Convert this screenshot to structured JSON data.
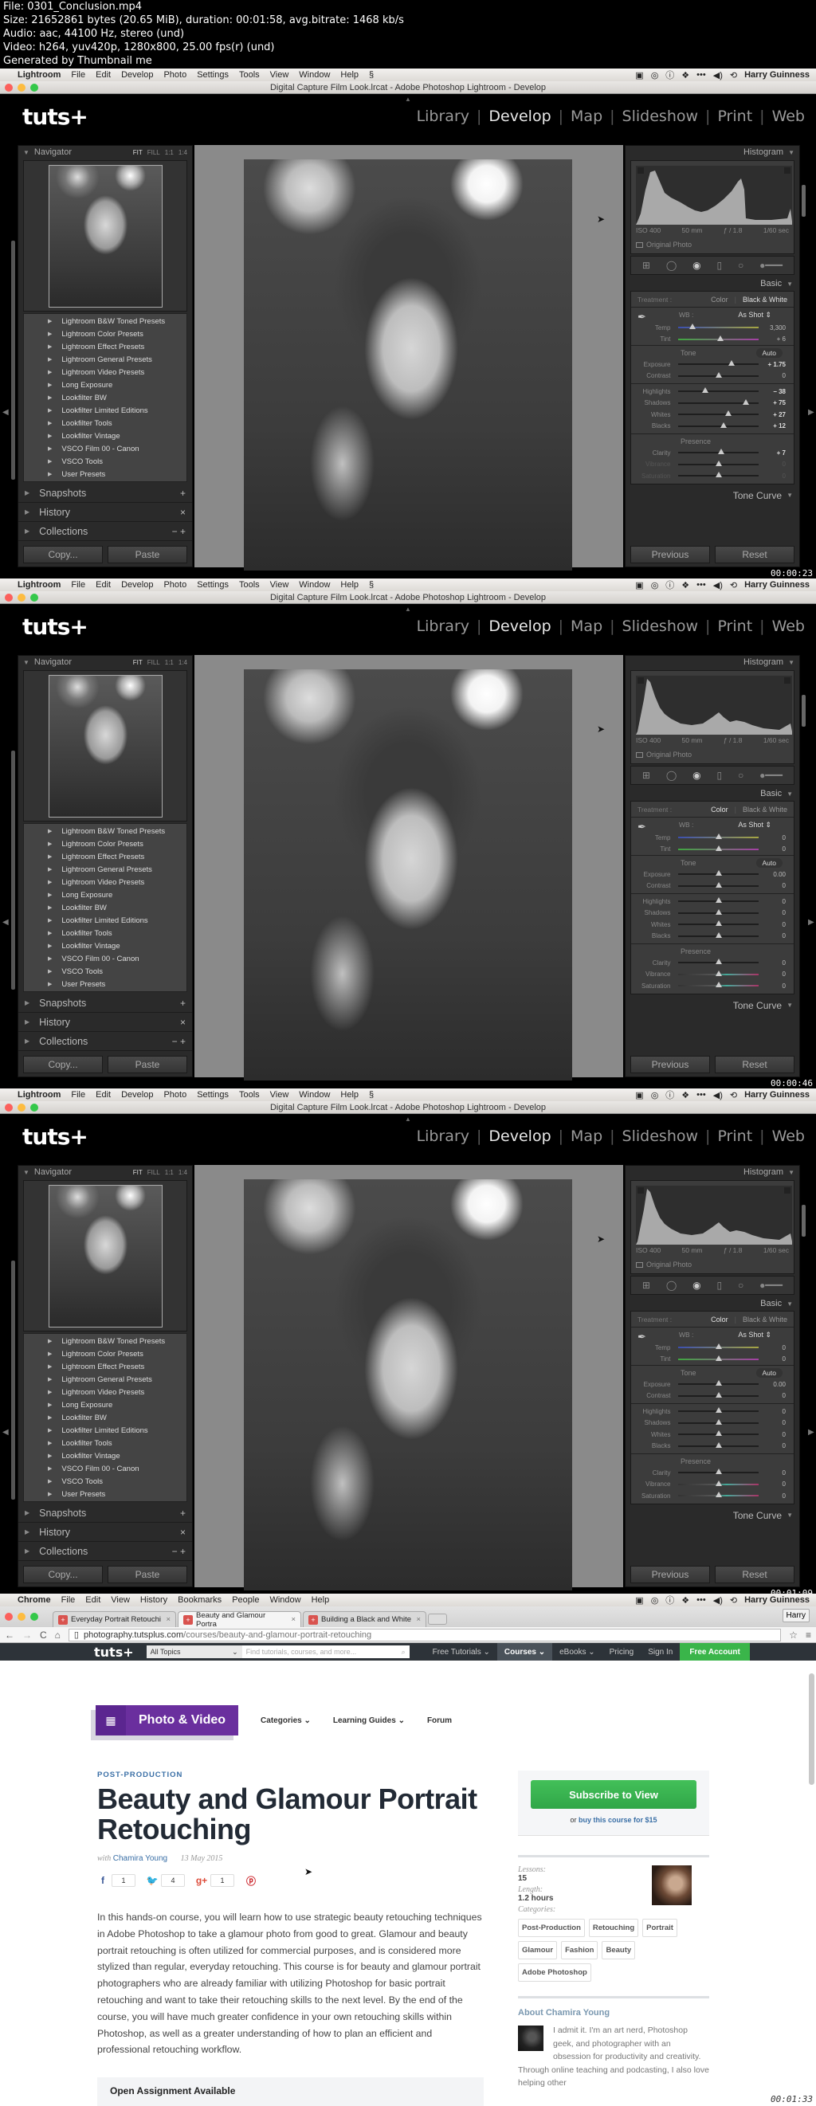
{
  "header": {
    "lines": [
      "File: 0301_Conclusion.mp4",
      "Size: 21652861 bytes (20.65 MiB), duration: 00:01:58, avg.bitrate: 1468 kb/s",
      "Audio: aac, 44100 Hz, stereo (und)",
      "Video: h264, yuv420p, 1280x800, 25.00 fps(r) (und)",
      "Generated by Thumbnail me"
    ]
  },
  "lightroom": {
    "menubar": {
      "app": "Lightroom",
      "items": [
        "File",
        "Edit",
        "Develop",
        "Photo",
        "Settings",
        "Tools",
        "View",
        "Window",
        "Help"
      ],
      "user": "Harry Guinness"
    },
    "window_title": "Digital Capture Film Look.lrcat - Adobe Photoshop Lightroom - Develop",
    "logo": "tuts+",
    "modules": [
      "Library",
      "Develop",
      "Map",
      "Slideshow",
      "Print",
      "Web"
    ],
    "active_module": "Develop",
    "navigator": {
      "title": "Navigator",
      "zoom_options": [
        "FIT",
        "FILL",
        "1:1",
        "1:4"
      ]
    },
    "presets": [
      "Lightroom B&W Toned Presets",
      "Lightroom Color Presets",
      "Lightroom Effect Presets",
      "Lightroom General Presets",
      "Lightroom Video Presets",
      "Long Exposure",
      "Lookfilter BW",
      "Lookfilter Limited Editions",
      "Lookfilter Tools",
      "Lookfilter Vintage",
      "VSCO Film 00 - Canon",
      "VSCO Tools",
      "User Presets"
    ],
    "left_sections": [
      {
        "label": "Snapshots",
        "action": "+"
      },
      {
        "label": "History",
        "action": "×"
      },
      {
        "label": "Collections",
        "action": "− +"
      }
    ],
    "left_buttons": [
      "Copy...",
      "Paste"
    ],
    "histogram": {
      "title": "Histogram",
      "iso": "ISO 400",
      "focal": "50 mm",
      "aperture": "ƒ / 1.8",
      "shutter": "1/60 sec",
      "original_photo": "Original Photo"
    },
    "basic_title": "Basic",
    "treatment_label": "Treatment :",
    "treatment_options": [
      "Color",
      "Black & White"
    ],
    "wb_label": "WB :",
    "wb_value": "As Shot",
    "tone_label": "Tone",
    "auto_label": "Auto",
    "presence_label": "Presence",
    "tone_curve": "Tone Curve",
    "right_buttons": [
      "Previous",
      "Reset"
    ],
    "frames": [
      {
        "timestamp": "00:00:23",
        "treatment_active": "Black & White",
        "sliders": [
          {
            "label": "Temp",
            "value": "3,300",
            "pos": 0.17
          },
          {
            "label": "Tint",
            "value": "+ 6",
            "pos": 0.52
          },
          {
            "label": "Exposure",
            "value": "+ 1.75",
            "pos": 0.66
          },
          {
            "label": "Contrast",
            "value": "0",
            "pos": 0.5
          },
          {
            "label": "Highlights",
            "value": "− 38",
            "pos": 0.33
          },
          {
            "label": "Shadows",
            "value": "+ 75",
            "pos": 0.84
          },
          {
            "label": "Whites",
            "value": "+ 27",
            "pos": 0.62
          },
          {
            "label": "Blacks",
            "value": "+ 12",
            "pos": 0.56
          },
          {
            "label": "Clarity",
            "value": "+ 7",
            "pos": 0.53
          },
          {
            "label": "Vibrance",
            "value": "0",
            "pos": 0.5
          },
          {
            "label": "Saturation",
            "value": "0",
            "pos": 0.5
          }
        ]
      },
      {
        "timestamp": "00:00:46",
        "treatment_active": "Color",
        "sliders": [
          {
            "label": "Temp",
            "value": "0",
            "pos": 0.5
          },
          {
            "label": "Tint",
            "value": "0",
            "pos": 0.5
          },
          {
            "label": "Exposure",
            "value": "0.00",
            "pos": 0.5
          },
          {
            "label": "Contrast",
            "value": "0",
            "pos": 0.5
          },
          {
            "label": "Highlights",
            "value": "0",
            "pos": 0.5
          },
          {
            "label": "Shadows",
            "value": "0",
            "pos": 0.5
          },
          {
            "label": "Whites",
            "value": "0",
            "pos": 0.5
          },
          {
            "label": "Blacks",
            "value": "0",
            "pos": 0.5
          },
          {
            "label": "Clarity",
            "value": "0",
            "pos": 0.5
          },
          {
            "label": "Vibrance",
            "value": "0",
            "pos": 0.5
          },
          {
            "label": "Saturation",
            "value": "0",
            "pos": 0.5
          }
        ]
      },
      {
        "timestamp": "00:01:09",
        "treatment_active": "Color",
        "sliders": [
          {
            "label": "Temp",
            "value": "0",
            "pos": 0.5
          },
          {
            "label": "Tint",
            "value": "0",
            "pos": 0.5
          },
          {
            "label": "Exposure",
            "value": "0.00",
            "pos": 0.5
          },
          {
            "label": "Contrast",
            "value": "0",
            "pos": 0.5
          },
          {
            "label": "Highlights",
            "value": "0",
            "pos": 0.5
          },
          {
            "label": "Shadows",
            "value": "0",
            "pos": 0.5
          },
          {
            "label": "Whites",
            "value": "0",
            "pos": 0.5
          },
          {
            "label": "Blacks",
            "value": "0",
            "pos": 0.5
          },
          {
            "label": "Clarity",
            "value": "0",
            "pos": 0.5
          },
          {
            "label": "Vibrance",
            "value": "0",
            "pos": 0.5
          },
          {
            "label": "Saturation",
            "value": "0",
            "pos": 0.5
          }
        ]
      }
    ]
  },
  "browser": {
    "menubar": {
      "app": "Chrome",
      "items": [
        "File",
        "Edit",
        "View",
        "History",
        "Bookmarks",
        "People",
        "Window",
        "Help"
      ],
      "user": "Harry Guinness"
    },
    "tabs": [
      {
        "label": "Everyday Portrait Retouchi",
        "active": false
      },
      {
        "label": "Beauty and Glamour Portra",
        "active": true
      },
      {
        "label": "Building a Black and White",
        "active": false
      }
    ],
    "profile": "Harry",
    "url_host": "photography.tutsplus.com",
    "url_path": "/courses/beauty-and-glamour-portrait-retouching",
    "site_nav": {
      "logo": "tuts+",
      "topics": "All Topics",
      "search_placeholder": "Find tutorials, courses, and more...",
      "items": [
        "Free Tutorials ⌄",
        "Courses ⌄",
        "eBooks ⌄",
        "Pricing",
        "Sign In"
      ],
      "active": "Courses ⌄",
      "cta": "Free Account"
    },
    "section_badge": "Photo & Video",
    "section_links": [
      "Categories ⌄",
      "Learning Guides ⌄",
      "Forum"
    ],
    "course": {
      "eyebrow": "POST-PRODUCTION",
      "title": "Beauty and Glamour Portrait Retouching",
      "with": "with",
      "author": "Chamira Young",
      "date": "13 May 2015",
      "shares": {
        "facebook": "1",
        "twitter": "4",
        "googleplus": "1"
      },
      "description": "In this hands-on course, you will learn how to use strategic beauty retouching techniques in Adobe Photoshop to take a glamour photo from good to great. Glamour and beauty portrait retouching is often utilized for commercial purposes, and is considered more stylized than regular, everyday retouching. This course is for beauty and glamour portrait photographers who are already familiar with utilizing Photoshop for basic portrait retouching and want to take their retouching skills to the next level. By the end of the course, you will have much greater confidence in your own retouching skills within Photoshop, as well as a greater understanding of how to plan an efficient and professional retouching workflow.",
      "assignment": "Open Assignment Available"
    },
    "sidebar": {
      "subscribe": "Subscribe to View",
      "buy_prefix": "or",
      "buy_link": "buy this course for $15",
      "lessons_label": "Lessons:",
      "lessons": "15",
      "length_label": "Length:",
      "length": "1.2 hours",
      "categories_label": "Categories:",
      "categories": [
        "Post-Production",
        "Retouching",
        "Portrait",
        "Glamour",
        "Fashion",
        "Beauty",
        "Adobe Photoshop"
      ],
      "about_title": "About Chamira Young",
      "bio": "I admit it. I'm an art nerd, Photoshop geek, and photographer with an obsession for productivity and creativity. Through online teaching and podcasting, I also love helping other"
    },
    "timestamp": "00:01:33"
  },
  "colors": {
    "tuts_purple": "#6a2f9e",
    "subscribe_green": "#3ab54a",
    "link_blue": "#3a6fa6",
    "lr_panel": "#2a2a2a"
  }
}
